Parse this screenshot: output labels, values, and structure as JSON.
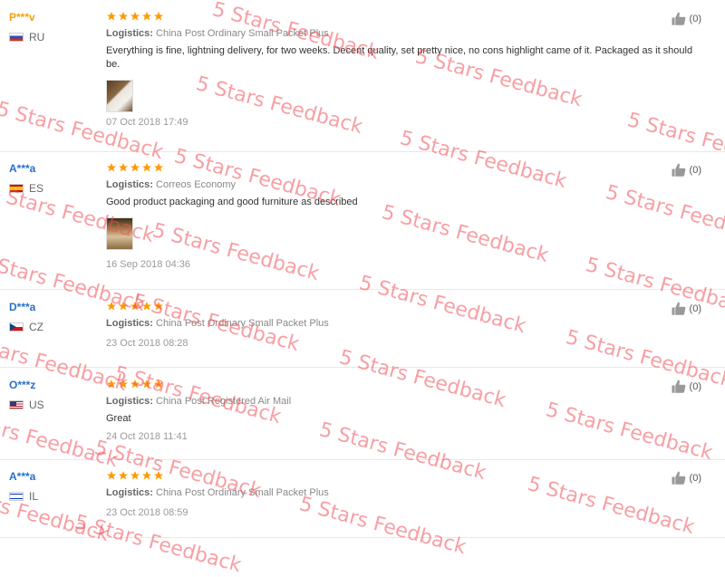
{
  "reviews": [
    {
      "user": "P***v",
      "country": "RU",
      "stars": 5,
      "logistics_label": "Logistics:",
      "logistics": "China Post Ordinary Small Packet Plus",
      "text": "Everything is fine, lightning delivery, for two weeks. Decent quality, set pretty nice, no cons highlight came of it. Packaged as it should be.",
      "date": "07 Oct 2018 17:49",
      "helpful": "(0)",
      "has_photo": true
    },
    {
      "user": "A***a",
      "country": "ES",
      "stars": 5,
      "logistics_label": "Logistics:",
      "logistics": "Correos Economy",
      "text": "Good product packaging and good furniture as described",
      "date": "16 Sep 2018 04:36",
      "helpful": "(0)",
      "has_photo": true
    },
    {
      "user": "D***a",
      "country": "CZ",
      "stars": 5,
      "logistics_label": "Logistics:",
      "logistics": "China Post Ordinary Small Packet Plus",
      "text": "",
      "date": "23 Oct 2018 08:28",
      "helpful": "(0)",
      "has_photo": false
    },
    {
      "user": "O***z",
      "country": "US",
      "stars": 5,
      "logistics_label": "Logistics:",
      "logistics": "China Post Registered Air Mail",
      "text": "Great",
      "date": "24 Oct 2018 11:41",
      "helpful": "(0)",
      "has_photo": false
    },
    {
      "user": "A***a",
      "country": "IL",
      "stars": 5,
      "logistics_label": "Logistics:",
      "logistics": "China Post Ordinary Small Packet Plus",
      "text": "",
      "date": "23 Oct 2018 08:59",
      "helpful": "(0)",
      "has_photo": false
    }
  ],
  "watermark_text": "5 Stars Feedback",
  "colors": {
    "star": "#ff9900",
    "username": "#2770c6",
    "username_highlight": "#f0a30a",
    "watermark": "#f0505a"
  }
}
